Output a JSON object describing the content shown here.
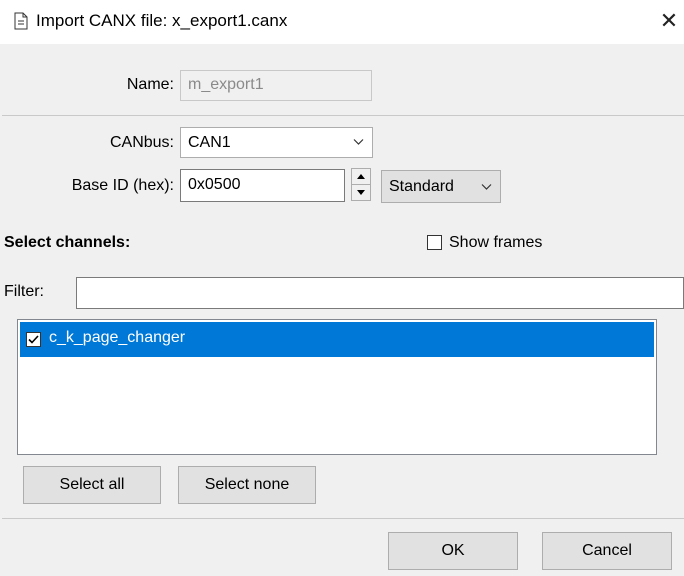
{
  "window": {
    "title": "Import CANX file: x_export1.canx",
    "close_glyph": "✕"
  },
  "form": {
    "name_label": "Name:",
    "name_value": "m_export1",
    "canbus_label": "CANbus:",
    "canbus_value": "CAN1",
    "base_id_label": "Base ID (hex):",
    "base_id_value": "0x0500",
    "id_type_value": "Standard"
  },
  "channels": {
    "heading": "Select channels:",
    "show_frames_label": "Show frames",
    "show_frames_checked": false,
    "filter_label": "Filter:",
    "filter_value": "",
    "items": [
      {
        "label": "c_k_page_changer",
        "checked": true,
        "selected": true
      }
    ],
    "select_all_label": "Select all",
    "select_none_label": "Select none"
  },
  "footer": {
    "ok_label": "OK",
    "cancel_label": "Cancel"
  },
  "colors": {
    "selection": "#0078d7",
    "dialog_bg": "#f0f0f0"
  }
}
